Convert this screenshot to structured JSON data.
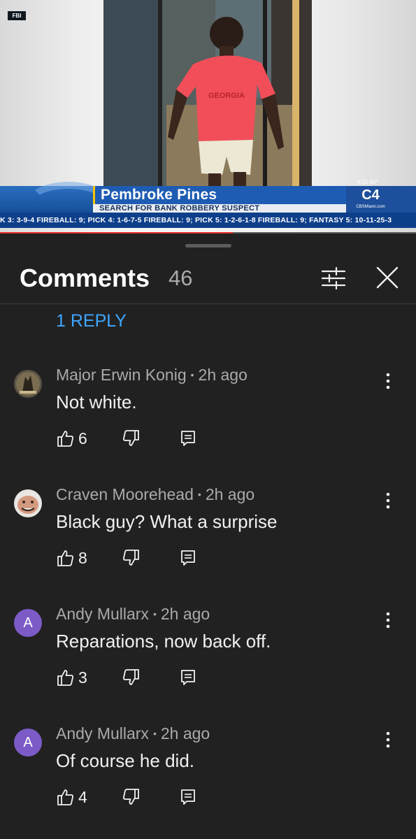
{
  "video": {
    "watermark": "FBI",
    "location_title": "Pembroke Pines",
    "headline": "SEARCH FOR BANK ROBBERY SUSPECT",
    "clock": "4:51 80°",
    "channel": "C4",
    "website": "CBSMiami.com",
    "ticker": "K 3: 3-9-4 FIREBALL: 9;  PICK 4: 1-6-7-5 FIREBALL: 9;  PICK 5: 1-2-6-1-8 FIREBALL: 9;  FANTASY 5: 10-11-25-3",
    "progress_fraction": 0.56,
    "colors": {
      "banner_blue": "#1e5cb3",
      "ticker_blue": "#0e3f8a",
      "progress_red": "#e52d27"
    }
  },
  "comments_panel": {
    "title": "Comments",
    "count": "46",
    "filter_icon": "sliders-icon",
    "close_icon": "close-icon",
    "reply_link": "1 REPLY",
    "colors": {
      "background": "#212121",
      "link": "#3ea6ff",
      "muted_text": "#aaaaaa"
    }
  },
  "comments": [
    {
      "author": "Major Erwin Konig",
      "time": "2h ago",
      "text": "Not white.",
      "likes": "6",
      "avatar": "photo"
    },
    {
      "author": "Craven Moorehead",
      "time": "2h ago",
      "text": "Black guy? What a surprise",
      "likes": "8",
      "avatar": "photo"
    },
    {
      "author": "Andy Mullarx",
      "time": "2h ago",
      "text": "Reparations, now back off.",
      "likes": "3",
      "avatar": "A"
    },
    {
      "author": "Andy Mullarx",
      "time": "2h ago",
      "text": "Of course he did.",
      "likes": "4",
      "avatar": "A"
    }
  ]
}
